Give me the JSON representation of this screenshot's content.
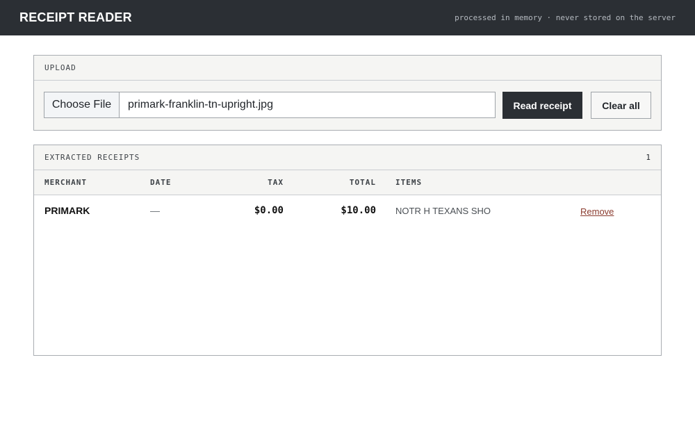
{
  "header": {
    "title": "RECEIPT READER",
    "tagline": "processed in memory · never stored on the server"
  },
  "upload": {
    "section_label": "UPLOAD",
    "choose_label": "Choose File",
    "file_name": "primark-franklin-tn-upright.jpg",
    "read_label": "Read receipt",
    "clear_label": "Clear all"
  },
  "receipts": {
    "section_label": "EXTRACTED RECEIPTS",
    "count": "1",
    "columns": {
      "merchant": "MERCHANT",
      "date": "DATE",
      "tax": "TAX",
      "total": "TOTAL",
      "items": "ITEMS"
    },
    "rows": [
      {
        "merchant": "PRIMARK",
        "date": "—",
        "tax": "$0.00",
        "total": "$10.00",
        "items": "NOTR H TEXANS SHO",
        "action": "Remove"
      }
    ]
  },
  "colors": {
    "topbar": "#2b2f34",
    "panel_bg": "#f5f5f3",
    "remove_link": "#8a3b2e"
  }
}
